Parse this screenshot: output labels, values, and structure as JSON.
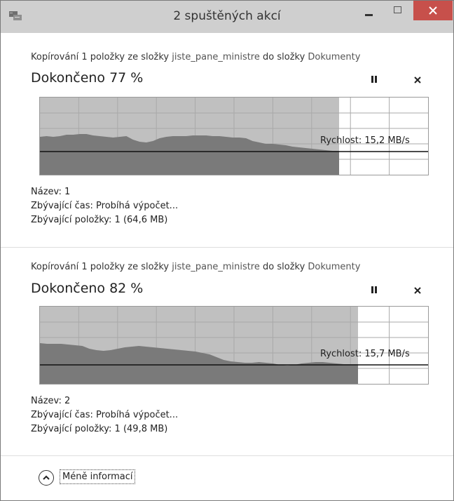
{
  "window": {
    "title": "2 spuštěných akcí",
    "close_color": "#c7504b",
    "titlebar_color": "#cfcfcf"
  },
  "operations": [
    {
      "prefix": "Kopírování 1 položky ze složky",
      "source": "jiste_pane_ministre",
      "connector": "do složky",
      "target": "Dokumenty",
      "status": "Dokončeno 77 %",
      "progress_fraction": 0.77,
      "speed": "Rychlost: 15,2 MB/s",
      "name_line": "Název: 1",
      "time_line": "Zbývající čas:  Probíhá výpočet...",
      "items_line": "Zbývající položky: 1 (64,6 MB)"
    },
    {
      "prefix": "Kopírování 1 položky ze složky",
      "source": "jiste_pane_ministre",
      "connector": "do složky",
      "target": "Dokumenty",
      "status": "Dokončeno 82 %",
      "progress_fraction": 0.82,
      "speed": "Rychlost: 15,7 MB/s",
      "name_line": "Název: 2",
      "time_line": "Zbývající čas:  Probíhá výpočet...",
      "items_line": "Zbývající položky: 1 (49,8 MB)"
    }
  ],
  "footer": {
    "toggle_label": "Méně informací"
  },
  "colors": {
    "graph_fill_light": "#c0c0c0",
    "graph_fill_dark": "#7a7a7a",
    "graph_grid": "#a9a9a9"
  }
}
